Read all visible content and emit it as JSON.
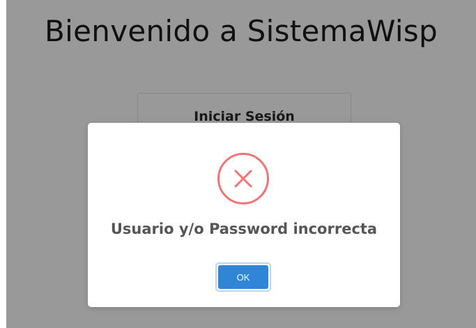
{
  "page": {
    "title": "Bienvenido a SistemaWisp"
  },
  "login": {
    "title": "Iniciar Sesión"
  },
  "modal": {
    "icon": "error-x-icon",
    "message": "Usuario y/o Password incorrecta",
    "ok_label": "OK"
  },
  "colors": {
    "error": "#f27474",
    "confirm_button": "#3085d6",
    "overlay": "rgba(0,0,0,0.4)"
  }
}
